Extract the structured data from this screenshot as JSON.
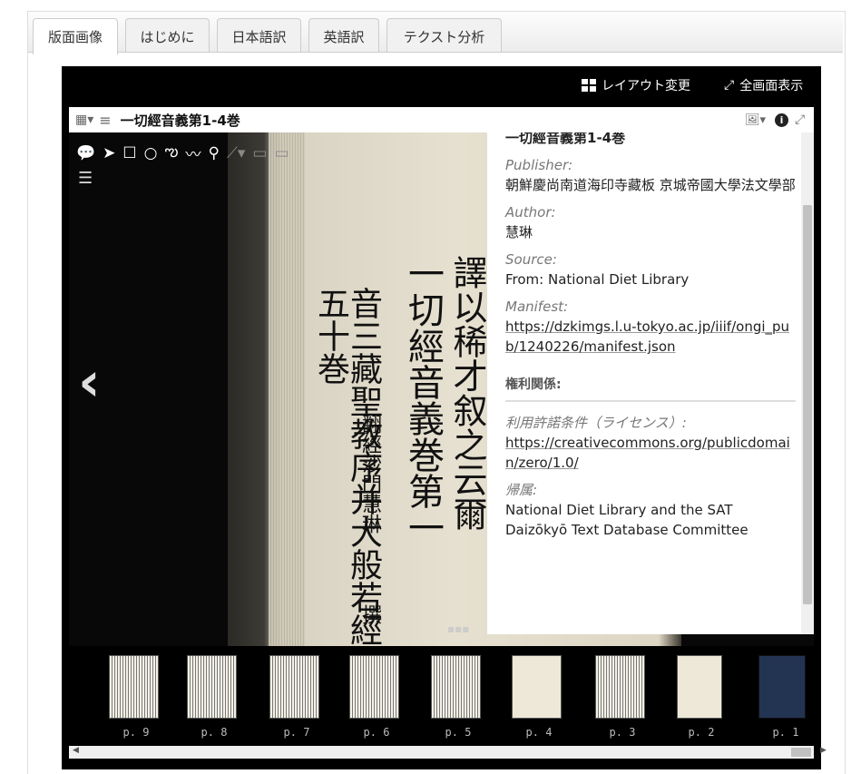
{
  "tabs": [
    {
      "label": "版面画像",
      "active": true
    },
    {
      "label": "はじめに"
    },
    {
      "label": "日本語訳"
    },
    {
      "label": "英語訳"
    },
    {
      "label": "テクスト分析"
    }
  ],
  "toolbar": {
    "layout_label": "レイアウト変更",
    "fullscreen_label": "全画面表示"
  },
  "panel": {
    "title": "一切經音義第1-4巻"
  },
  "info": {
    "title": "一切經音義第1-4巻",
    "publisher_label": "Publisher:",
    "publisher": "朝鮮慶尚南道海印寺藏板 京城帝國大學法文學部",
    "author_label": "Author:",
    "author": "慧琳",
    "source_label": "Source:",
    "source": "From: National Diet Library",
    "manifest_label": "Manifest:",
    "manifest": "https://dzkimgs.l.u-tokyo.ac.jp/iiif/ongi_pub/1240226/manifest.json",
    "rights_heading": "権利関係:",
    "license_label": "利用許諾条件（ライセンス）:",
    "license": "https://creativecommons.org/publicdomain/zero/1.0/",
    "attribution_label": "帰属:",
    "attribution": "National Diet Library and the SAT Daizōkyō Text Database Committee"
  },
  "page_text": {
    "col1": "音三藏聖教序并大般若經五十巻",
    "col2": "一切經音義巻第一",
    "col3": "翻經沙門慧琳",
    "col4": "撰",
    "col5": "譯以稀才叙之云爾"
  },
  "thumbnails": [
    "p. 9",
    "p. 8",
    "p. 7",
    "p. 6",
    "p. 5",
    "p. 4",
    "p. 3",
    "p. 2",
    "p. 1"
  ],
  "colors": {
    "viewer_bg": "#000000",
    "cover_blue": "#233352"
  }
}
